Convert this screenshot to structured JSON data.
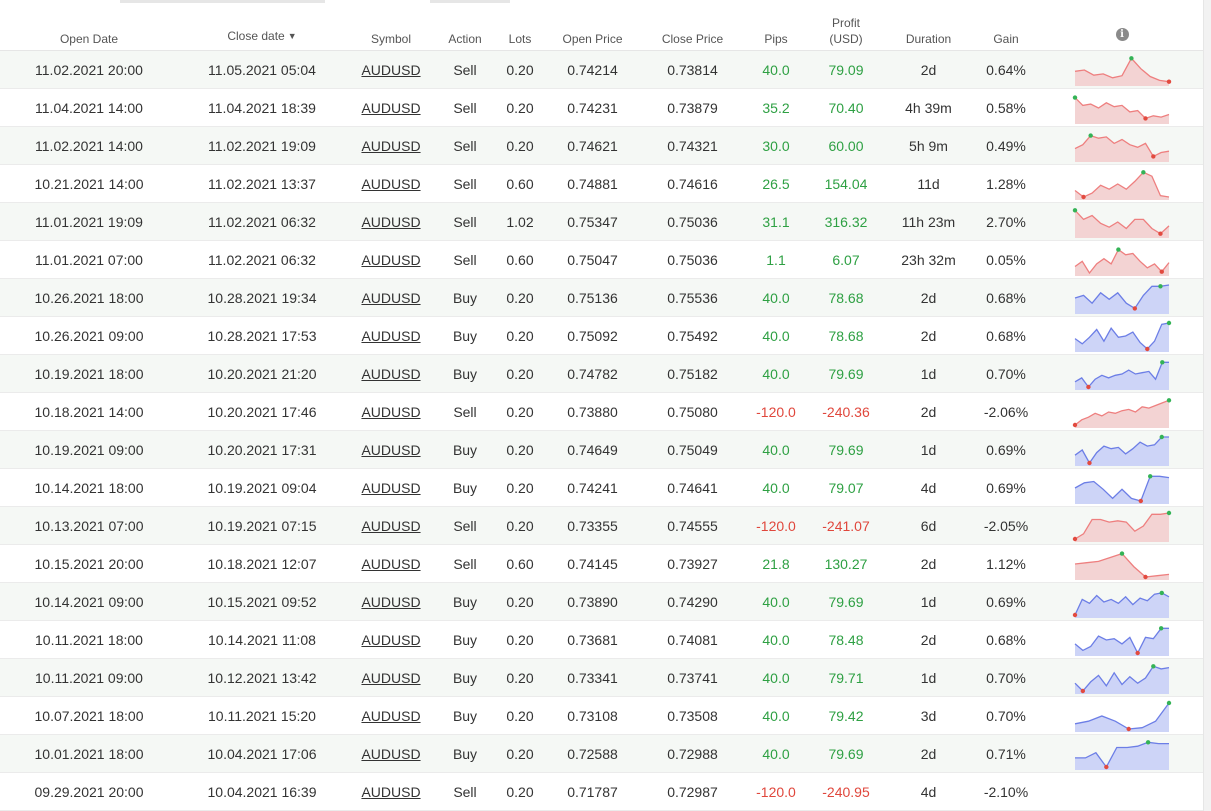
{
  "headers": {
    "open_date": "Open Date",
    "close_date": "Close date",
    "symbol": "Symbol",
    "action": "Action",
    "lots": "Lots",
    "open_price": "Open Price",
    "close_price": "Close Price",
    "pips": "Pips",
    "profit_line1": "Profit",
    "profit_line2": "(USD)",
    "duration": "Duration",
    "gain": "Gain",
    "sort_icon": "caret-down-icon",
    "info_icon": "info-icon"
  },
  "colors": {
    "positive": "#2ea043",
    "negative": "#e0473c",
    "sell_fill": "#f3d3d3",
    "sell_stroke": "#ee7f7f",
    "buy_fill": "#cdd4f7",
    "buy_stroke": "#6c7ee6",
    "max_dot": "#34b356",
    "min_dot": "#e24a3f"
  },
  "rows": [
    {
      "open": "11.02.2021 20:00",
      "close": "11.05.2021 05:04",
      "symbol": "AUDUSD",
      "action": "Sell",
      "lots": "0.20",
      "open_price": "0.74214",
      "close_price": "0.73814",
      "pips": "40.0",
      "profit": "79.09",
      "duration": "2d",
      "gain": "0.64%",
      "sign": "pos",
      "spark": [
        0.45,
        0.5,
        0.3,
        0.35,
        0.2,
        0.28,
        0.95,
        0.55,
        0.25,
        0.1,
        0.05
      ],
      "spark_max": 6,
      "spark_min": 10
    },
    {
      "open": "11.04.2021 14:00",
      "close": "11.04.2021 18:39",
      "symbol": "AUDUSD",
      "action": "Sell",
      "lots": "0.20",
      "open_price": "0.74231",
      "close_price": "0.73879",
      "pips": "35.2",
      "profit": "70.40",
      "duration": "4h 39m",
      "gain": "0.58%",
      "sign": "pos",
      "spark": [
        0.9,
        0.6,
        0.65,
        0.5,
        0.7,
        0.55,
        0.6,
        0.35,
        0.4,
        0.1,
        0.2,
        0.15,
        0.25
      ],
      "spark_max": 0,
      "spark_min": 9
    },
    {
      "open": "11.02.2021 14:00",
      "close": "11.02.2021 19:09",
      "symbol": "AUDUSD",
      "action": "Sell",
      "lots": "0.20",
      "open_price": "0.74621",
      "close_price": "0.74321",
      "pips": "30.0",
      "profit": "60.00",
      "duration": "5h 9m",
      "gain": "0.49%",
      "sign": "pos",
      "spark": [
        0.4,
        0.55,
        0.9,
        0.8,
        0.85,
        0.6,
        0.75,
        0.55,
        0.45,
        0.6,
        0.1,
        0.25,
        0.3
      ],
      "spark_max": 2,
      "spark_min": 10
    },
    {
      "open": "10.21.2021 14:00",
      "close": "11.02.2021 13:37",
      "symbol": "AUDUSD",
      "action": "Sell",
      "lots": "0.60",
      "open_price": "0.74881",
      "close_price": "0.74616",
      "pips": "26.5",
      "profit": "154.04",
      "duration": "11d",
      "gain": "1.28%",
      "sign": "pos",
      "spark": [
        0.25,
        0.0,
        0.15,
        0.45,
        0.3,
        0.5,
        0.3,
        0.6,
        0.95,
        0.8,
        0.05,
        0.0
      ],
      "spark_max": 8,
      "spark_min": 1
    },
    {
      "open": "11.01.2021 19:09",
      "close": "11.02.2021 06:32",
      "symbol": "AUDUSD",
      "action": "Sell",
      "lots": "1.02",
      "open_price": "0.75347",
      "close_price": "0.75036",
      "pips": "31.1",
      "profit": "316.32",
      "duration": "11h 23m",
      "gain": "2.70%",
      "sign": "pos",
      "spark": [
        0.95,
        0.6,
        0.75,
        0.45,
        0.3,
        0.5,
        0.25,
        0.6,
        0.6,
        0.25,
        0.05,
        0.35
      ],
      "spark_max": 0,
      "spark_min": 10
    },
    {
      "open": "11.01.2021 07:00",
      "close": "11.02.2021 06:32",
      "symbol": "AUDUSD",
      "action": "Sell",
      "lots": "0.60",
      "open_price": "0.75047",
      "close_price": "0.75036",
      "pips": "1.1",
      "profit": "6.07",
      "duration": "23h 32m",
      "gain": "0.05%",
      "sign": "pos",
      "spark": [
        0.25,
        0.45,
        0.0,
        0.35,
        0.55,
        0.35,
        0.9,
        0.7,
        0.75,
        0.45,
        0.2,
        0.35,
        0.05,
        0.4
      ],
      "spark_max": 6,
      "spark_min": 12
    },
    {
      "open": "10.26.2021 18:00",
      "close": "10.28.2021 19:34",
      "symbol": "AUDUSD",
      "action": "Buy",
      "lots": "0.20",
      "open_price": "0.75136",
      "close_price": "0.75536",
      "pips": "40.0",
      "profit": "78.68",
      "duration": "2d",
      "gain": "0.68%",
      "sign": "pos",
      "spark": [
        0.5,
        0.6,
        0.3,
        0.7,
        0.45,
        0.7,
        0.3,
        0.1,
        0.6,
        0.95,
        0.95,
        1.0
      ],
      "spark_max": 10,
      "spark_min": 7
    },
    {
      "open": "10.26.2021 09:00",
      "close": "10.28.2021 17:53",
      "symbol": "AUDUSD",
      "action": "Buy",
      "lots": "0.20",
      "open_price": "0.75092",
      "close_price": "0.75492",
      "pips": "40.0",
      "profit": "78.68",
      "duration": "2d",
      "gain": "0.68%",
      "sign": "pos",
      "spark": [
        0.4,
        0.2,
        0.45,
        0.75,
        0.3,
        0.8,
        0.45,
        0.5,
        0.65,
        0.25,
        0.0,
        0.3,
        0.95,
        1.0
      ],
      "spark_max": 13,
      "spark_min": 10
    },
    {
      "open": "10.19.2021 18:00",
      "close": "10.20.2021 21:20",
      "symbol": "AUDUSD",
      "action": "Buy",
      "lots": "0.20",
      "open_price": "0.74782",
      "close_price": "0.75182",
      "pips": "40.0",
      "profit": "79.69",
      "duration": "1d",
      "gain": "0.70%",
      "sign": "pos",
      "spark": [
        0.2,
        0.35,
        0.0,
        0.3,
        0.45,
        0.35,
        0.45,
        0.5,
        0.65,
        0.5,
        0.55,
        0.6,
        0.3,
        0.95,
        0.95
      ],
      "spark_max": 13,
      "spark_min": 2
    },
    {
      "open": "10.18.2021 14:00",
      "close": "10.20.2021 17:46",
      "symbol": "AUDUSD",
      "action": "Sell",
      "lots": "0.20",
      "open_price": "0.73880",
      "close_price": "0.75080",
      "pips": "-120.0",
      "profit": "-240.36",
      "duration": "2d",
      "gain": "-2.06%",
      "sign": "neg",
      "spark": [
        0.0,
        0.2,
        0.3,
        0.45,
        0.35,
        0.5,
        0.45,
        0.55,
        0.6,
        0.5,
        0.7,
        0.65,
        0.75,
        0.85,
        0.95
      ],
      "spark_max": 14,
      "spark_min": 0
    },
    {
      "open": "10.19.2021 09:00",
      "close": "10.20.2021 17:31",
      "symbol": "AUDUSD",
      "action": "Buy",
      "lots": "0.20",
      "open_price": "0.74649",
      "close_price": "0.75049",
      "pips": "40.0",
      "profit": "79.69",
      "duration": "1d",
      "gain": "0.69%",
      "sign": "pos",
      "spark": [
        0.3,
        0.5,
        0.0,
        0.4,
        0.65,
        0.55,
        0.6,
        0.35,
        0.55,
        0.8,
        0.65,
        0.7,
        1.0,
        1.0
      ],
      "spark_max": 12,
      "spark_min": 2
    },
    {
      "open": "10.14.2021 18:00",
      "close": "10.19.2021 09:04",
      "symbol": "AUDUSD",
      "action": "Buy",
      "lots": "0.20",
      "open_price": "0.74241",
      "close_price": "0.74641",
      "pips": "40.0",
      "profit": "79.07",
      "duration": "4d",
      "gain": "0.69%",
      "sign": "pos",
      "spark": [
        0.5,
        0.7,
        0.75,
        0.45,
        0.1,
        0.45,
        0.1,
        0.0,
        0.95,
        0.95,
        0.9
      ],
      "spark_max": 8,
      "spark_min": 7
    },
    {
      "open": "10.13.2021 07:00",
      "close": "10.19.2021 07:15",
      "symbol": "AUDUSD",
      "action": "Sell",
      "lots": "0.20",
      "open_price": "0.73355",
      "close_price": "0.74555",
      "pips": "-120.0",
      "profit": "-241.07",
      "duration": "6d",
      "gain": "-2.05%",
      "sign": "neg",
      "spark": [
        0.0,
        0.2,
        0.75,
        0.75,
        0.65,
        0.7,
        0.65,
        0.3,
        0.5,
        0.95,
        0.95,
        1.0
      ],
      "spark_max": 11,
      "spark_min": 0
    },
    {
      "open": "10.15.2021 20:00",
      "close": "10.18.2021 12:07",
      "symbol": "AUDUSD",
      "action": "Sell",
      "lots": "0.60",
      "open_price": "0.74145",
      "close_price": "0.73927",
      "pips": "21.8",
      "profit": "130.27",
      "duration": "2d",
      "gain": "1.12%",
      "sign": "pos",
      "spark": [
        0.5,
        0.55,
        0.6,
        0.75,
        0.9,
        0.4,
        0.0,
        0.05,
        0.1
      ],
      "spark_max": 4,
      "spark_min": 6
    },
    {
      "open": "10.14.2021 09:00",
      "close": "10.15.2021 09:52",
      "symbol": "AUDUSD",
      "action": "Buy",
      "lots": "0.20",
      "open_price": "0.73890",
      "close_price": "0.74290",
      "pips": "40.0",
      "profit": "79.69",
      "duration": "1d",
      "gain": "0.69%",
      "sign": "pos",
      "spark": [
        0.0,
        0.6,
        0.45,
        0.75,
        0.5,
        0.6,
        0.45,
        0.7,
        0.4,
        0.65,
        0.55,
        0.8,
        0.85,
        0.7
      ],
      "spark_max": 12,
      "spark_min": 0
    },
    {
      "open": "10.11.2021 18:00",
      "close": "10.14.2021 11:08",
      "symbol": "AUDUSD",
      "action": "Buy",
      "lots": "0.20",
      "open_price": "0.73681",
      "close_price": "0.74081",
      "pips": "40.0",
      "profit": "78.48",
      "duration": "2d",
      "gain": "0.68%",
      "sign": "pos",
      "spark": [
        0.35,
        0.1,
        0.25,
        0.65,
        0.5,
        0.55,
        0.35,
        0.6,
        0.0,
        0.6,
        0.55,
        0.95,
        0.95
      ],
      "spark_max": 11,
      "spark_min": 8
    },
    {
      "open": "10.11.2021 09:00",
      "close": "10.12.2021 13:42",
      "symbol": "AUDUSD",
      "action": "Buy",
      "lots": "0.20",
      "open_price": "0.73341",
      "close_price": "0.73741",
      "pips": "40.0",
      "profit": "79.71",
      "duration": "1d",
      "gain": "0.70%",
      "sign": "pos",
      "spark": [
        0.3,
        0.0,
        0.35,
        0.6,
        0.2,
        0.7,
        0.25,
        0.55,
        0.3,
        0.5,
        0.95,
        0.85,
        0.9
      ],
      "spark_max": 10,
      "spark_min": 1
    },
    {
      "open": "10.07.2021 18:00",
      "close": "10.11.2021 15:20",
      "symbol": "AUDUSD",
      "action": "Buy",
      "lots": "0.20",
      "open_price": "0.73108",
      "close_price": "0.73508",
      "pips": "40.0",
      "profit": "79.42",
      "duration": "3d",
      "gain": "0.70%",
      "sign": "pos",
      "spark": [
        0.2,
        0.3,
        0.5,
        0.3,
        0.0,
        0.05,
        0.3,
        1.0
      ],
      "spark_max": 7,
      "spark_min": 4
    },
    {
      "open": "10.01.2021 18:00",
      "close": "10.04.2021 17:06",
      "symbol": "AUDUSD",
      "action": "Buy",
      "lots": "0.20",
      "open_price": "0.72588",
      "close_price": "0.72988",
      "pips": "40.0",
      "profit": "79.69",
      "duration": "2d",
      "gain": "0.71%",
      "sign": "pos",
      "spark": [
        0.35,
        0.35,
        0.55,
        0.0,
        0.75,
        0.75,
        0.8,
        0.95,
        0.9,
        0.9
      ],
      "spark_max": 7,
      "spark_min": 3
    },
    {
      "open": "09.29.2021 20:00",
      "close": "10.04.2021 16:39",
      "symbol": "AUDUSD",
      "action": "Sell",
      "lots": "0.20",
      "open_price": "0.71787",
      "close_price": "0.72987",
      "pips": "-120.0",
      "profit": "-240.95",
      "duration": "4d",
      "gain": "-2.10%",
      "sign": "neg",
      "spark": null,
      "spark_max": null,
      "spark_min": null
    }
  ]
}
